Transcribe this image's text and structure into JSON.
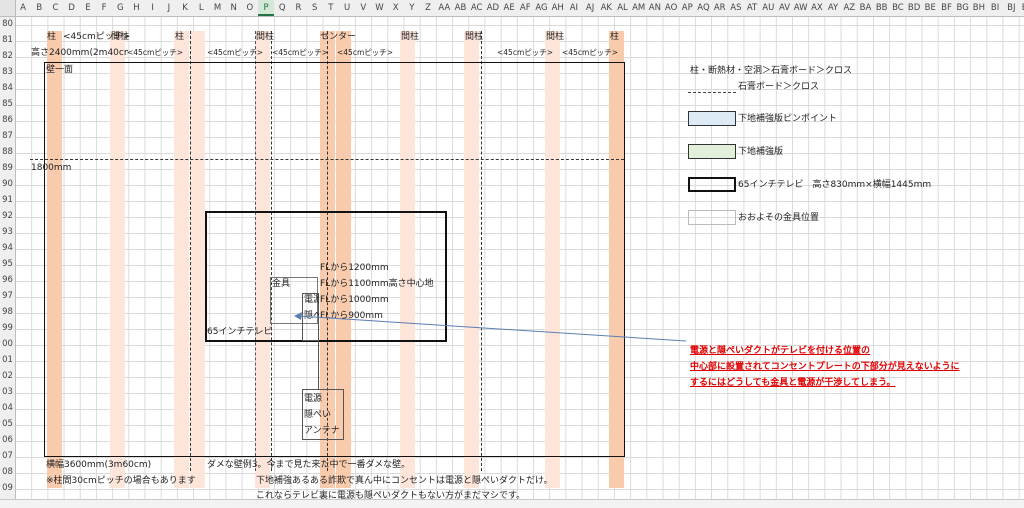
{
  "columns": [
    "A",
    "B",
    "C",
    "D",
    "E",
    "F",
    "G",
    "H",
    "I",
    "J",
    "K",
    "L",
    "M",
    "N",
    "O",
    "P",
    "Q",
    "R",
    "S",
    "T",
    "U",
    "V",
    "W",
    "X",
    "Y",
    "Z",
    "AA",
    "AB",
    "AC",
    "AD",
    "AE",
    "AF",
    "AG",
    "AH",
    "AI",
    "AJ",
    "AK",
    "AL",
    "AM",
    "AN",
    "AO",
    "AP",
    "AQ",
    "AR",
    "AS",
    "AT",
    "AU",
    "AV",
    "AW",
    "AX",
    "AY",
    "AZ",
    "BA",
    "BB",
    "BC",
    "BD",
    "BE",
    "BF",
    "BG",
    "BH",
    "BI",
    "BJ",
    "BK"
  ],
  "selected_column": "P",
  "rows": [
    "80",
    "81",
    "82",
    "83",
    "84",
    "85",
    "86",
    "87",
    "88",
    "89",
    "90",
    "91",
    "92",
    "93",
    "94",
    "95",
    "96",
    "97",
    "98",
    "99",
    "00",
    "01",
    "02",
    "03",
    "04",
    "05",
    "06",
    "07",
    "08",
    "09"
  ],
  "header_row81": {
    "pillar1": "柱",
    "pitch1": "<45cmピッチ>",
    "mabashira1": "間柱",
    "pillar2": "柱",
    "mabashira2": "間柱",
    "center": "センター",
    "mabashira3": "間柱",
    "mabashira4": "間柱",
    "mabashira5": "間柱",
    "pillar3": "柱"
  },
  "header_row82": {
    "height": "高さ2400mm(2m40cm)",
    "pitch1": "<45cmピッチ>",
    "pitch2": "<45cmピッチ>",
    "pitch3": "<45cmピッチ>",
    "pitch4": "<45cmピッチ>",
    "pitch5": "<45cmピッチ>",
    "pitch6": "<45cmピッチ>"
  },
  "wall_label": "壁一面",
  "height_1800": "1800mm",
  "tv_label": "65インチテレビ",
  "bracket_label": "金具",
  "power_small1": "電源",
  "duct_small1": "隠ぺ",
  "fl_labels": {
    "l1200": "FLから1200mm",
    "l1100": "FLから1100mm高さ中心地",
    "l1000": "FLから1000mm",
    "l900": "FLから900mm"
  },
  "lower_box": {
    "power": "電源",
    "duct": "隠ぺい",
    "antenna": "アンテナ"
  },
  "width_label": "横幅3600mm(3m60cm)",
  "pitch_note": "※柱間30cmピッチの場合もあります",
  "bad_wall_title": "ダメな壁例3。今まで見た来た中で一番ダメな壁。",
  "bad_wall_line2": "下地補強あるある詐欺で真ん中にコンセントは電源と隠ぺいダクトだけ。",
  "bad_wall_line3": "これならテレビ裏に電源も隠ぺいダクトもない方がまだマシです。",
  "legend": {
    "line1": "柱・断熱材・空洞＞石膏ボード＞クロス",
    "line2": "石膏ボード＞クロス",
    "pinpoint": "下地補強版ピンポイント",
    "reinforce": "下地補強版",
    "tv": "65インチテレビ　高さ830mm×横幅1445mm",
    "bracket": "おおよその金具位置"
  },
  "annotation": {
    "line1": "電源と隠ぺいダクトがテレビを付ける位置の",
    "line2": "中心部に設置されてコンセントプレートの下部分が見えないように",
    "line3": "するにはどうしても金具と電源が干渉してしまう。"
  },
  "colors": {
    "pillar": "#f8cbad",
    "mabashira": "#fde5da",
    "pinpoint": "#ddebf7",
    "reinforce": "#e2efda",
    "annotation": "#e00000",
    "header_selected": "#217346"
  }
}
